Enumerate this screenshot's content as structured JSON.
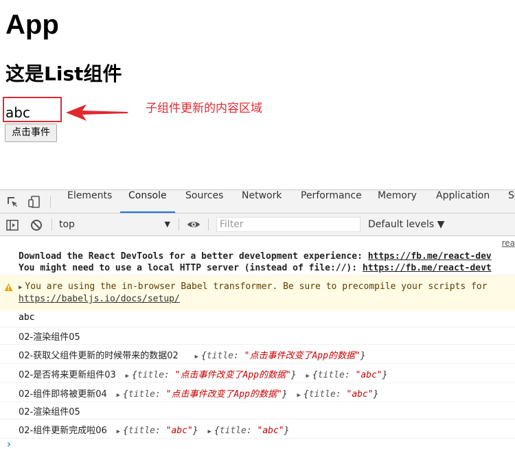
{
  "page": {
    "app_title": "App",
    "list_title": "这是List组件",
    "content_value": "abc",
    "annotation": "子组件更新的内容区域",
    "button_label": "点击事件"
  },
  "devtools": {
    "tabs": [
      "Elements",
      "Console",
      "Sources",
      "Network",
      "Performance",
      "Memory",
      "Application",
      "Se"
    ],
    "active_tab": "Console",
    "context": "top",
    "filter_placeholder": "Filter",
    "levels_label": "Default levels ▼",
    "source_link": "rea",
    "messages": {
      "devtools_line1_text": "Download the React DevTools for a better development experience: ",
      "devtools_line1_link": "https://fb.me/react-dev",
      "devtools_line2_text": "You might need to use a local HTTP server (instead of file://): ",
      "devtools_line2_link": "https://fb.me/react-devt",
      "warning_text": "You are using the in-browser Babel transformer. Be sure to precompile your scripts for",
      "warning_link": "https://babeljs.io/docs/setup/",
      "log1": "abc",
      "log2": "02-渲染组件05",
      "log3_label": "02-获取父组件更新的时候带来的数据02",
      "log3_obj_key": "title: ",
      "log3_obj_val": "\"点击事件改变了App的数据\"",
      "log4_label": "02-是否将来更新组件03",
      "log4_obj1_key": "title: ",
      "log4_obj1_val": "\"点击事件改变了App的数据\"",
      "log4_obj2_key": "title: ",
      "log4_obj2_val": "\"abc\"",
      "log5_label": "02-组件即将被更新04",
      "log5_obj1_key": "title: ",
      "log5_obj1_val": "\"点击事件改变了App的数据\"",
      "log5_obj2_key": "title: ",
      "log5_obj2_val": "\"abc\"",
      "log6": "02-渲染组件05",
      "log7_label": "02-组件更新完成啦06",
      "log7_obj1_key": "title: ",
      "log7_obj1_val": "\"abc\"",
      "log7_obj2_key": "title: ",
      "log7_obj2_val": "\"abc\"",
      "prompt": "›"
    }
  },
  "colors": {
    "annotation_red": "#e0292f",
    "accent_blue": "#1a73e8",
    "string_red": "#c80000"
  }
}
